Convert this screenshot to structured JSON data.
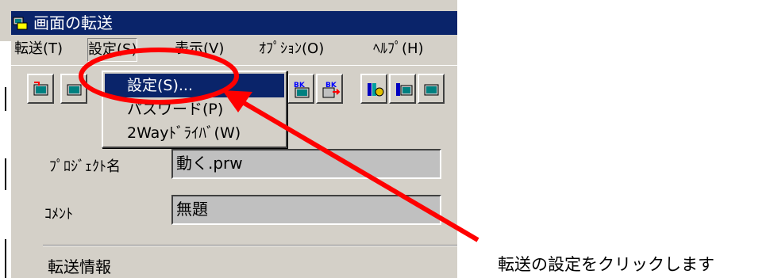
{
  "window": {
    "title": "画面の転送"
  },
  "menubar": {
    "items": [
      {
        "label": "転送(T)"
      },
      {
        "label": "設定(S)"
      },
      {
        "label": "表示(V)"
      },
      {
        "label": "ｵﾌﾟｼｮﾝ(O)"
      },
      {
        "label": "ﾍﾙﾌﾟ(H)"
      }
    ]
  },
  "dropdown": {
    "items": [
      {
        "label": "設定(S)...",
        "active": true
      },
      {
        "label": "パスワード(P)",
        "active": false
      },
      {
        "label": "2Wayﾄﾞﾗｲﾊﾞ(W)",
        "active": false
      }
    ]
  },
  "toolbar": {
    "icons": [
      "transfer-icon",
      "transfer-icon",
      "backup-icon",
      "backup-transfer-icon",
      "settings-icon",
      "transfer-icon"
    ],
    "badge": "BK"
  },
  "form": {
    "project_label": "ﾌﾟﾛｼﾞｪｸﾄ名",
    "project_value": "動く.prw",
    "comment_label": "ｺﾒﾝﾄ",
    "comment_value": "無題",
    "section_label": "転送情報"
  },
  "annotation": {
    "caption": "転送の設定をクリックします",
    "color": "#ff0000"
  },
  "colors": {
    "titlebar": "#0a246a",
    "face": "#d4d0c8",
    "highlight": "#0a246a"
  }
}
